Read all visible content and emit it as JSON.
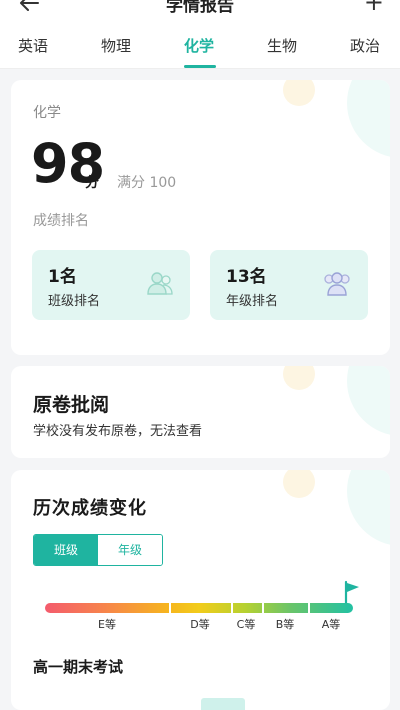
{
  "header": {
    "title": "学情报告"
  },
  "tabs": [
    {
      "label": "英语"
    },
    {
      "label": "物理"
    },
    {
      "label": "化学"
    },
    {
      "label": "生物"
    },
    {
      "label": "政治"
    }
  ],
  "score_card": {
    "subject": "化学",
    "score": "98",
    "unit": "分",
    "full_mark": "满分 100",
    "rank_title": "成绩排名",
    "class_rank": {
      "value": "1名",
      "label": "班级排名",
      "icon": "group-icon"
    },
    "grade_rank": {
      "value": "13名",
      "label": "年级排名",
      "icon": "group-icon"
    }
  },
  "paper_card": {
    "title": "原卷批阅",
    "desc": "学校没有发布原卷，无法查看"
  },
  "history_card": {
    "title": "历次成绩变化",
    "toggle": {
      "class": "班级",
      "grade": "年级",
      "selected": "班级"
    },
    "grades": [
      {
        "label": "E等"
      },
      {
        "label": "D等"
      },
      {
        "label": "C等"
      },
      {
        "label": "B等"
      },
      {
        "label": "A等"
      }
    ],
    "exam_title": "高一期末考试"
  },
  "colors": {
    "accent": "#1fb4a0",
    "rank_bg": "#e2f6f2"
  }
}
